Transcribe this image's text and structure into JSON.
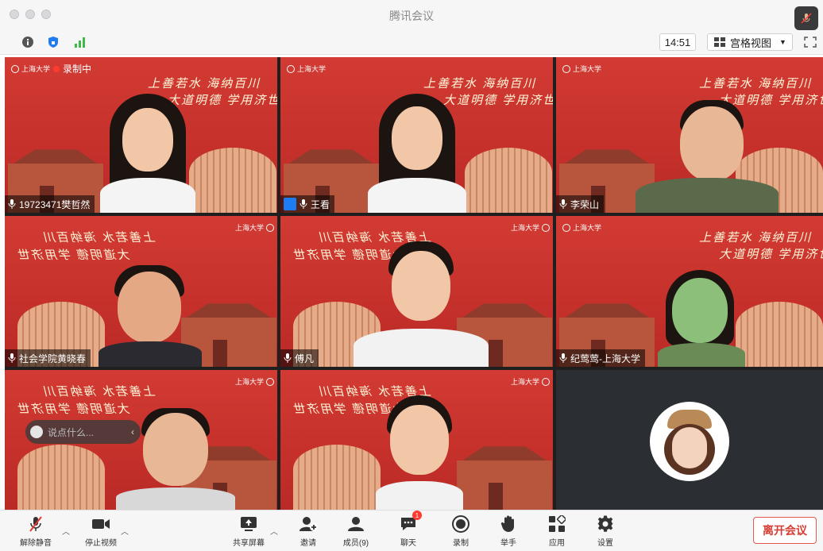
{
  "window": {
    "title": "腾讯会议"
  },
  "infobar": {
    "time": "14:51",
    "view_label": "宫格视图"
  },
  "slogan": {
    "line1": "上善若水  海纳百川",
    "line2": "大道明德  学用济世"
  },
  "university_logo": "上海大学",
  "recording_label": "录制中",
  "chat": {
    "placeholder": "说点什么..."
  },
  "tiles": [
    {
      "name": "19723471樊哲然"
    },
    {
      "name": "王看"
    },
    {
      "name": "李荣山"
    },
    {
      "name": "社会学院黄晓春"
    },
    {
      "name": "傅凡"
    },
    {
      "name": "纪莺莺-上海大学"
    }
  ],
  "toolbar": {
    "mute": "解除静音",
    "video": "停止视频",
    "share": "共享屏幕",
    "invite": "邀请",
    "members": "成员(9)",
    "chat": "聊天",
    "chat_badge": "1",
    "record": "录制",
    "raise_hand": "举手",
    "apps": "应用",
    "settings": "设置",
    "leave": "离开会议"
  },
  "colors": {
    "accent_red": "#d63c31",
    "active_speaker": "#6cc04a",
    "tile_red": "#c8332e"
  }
}
